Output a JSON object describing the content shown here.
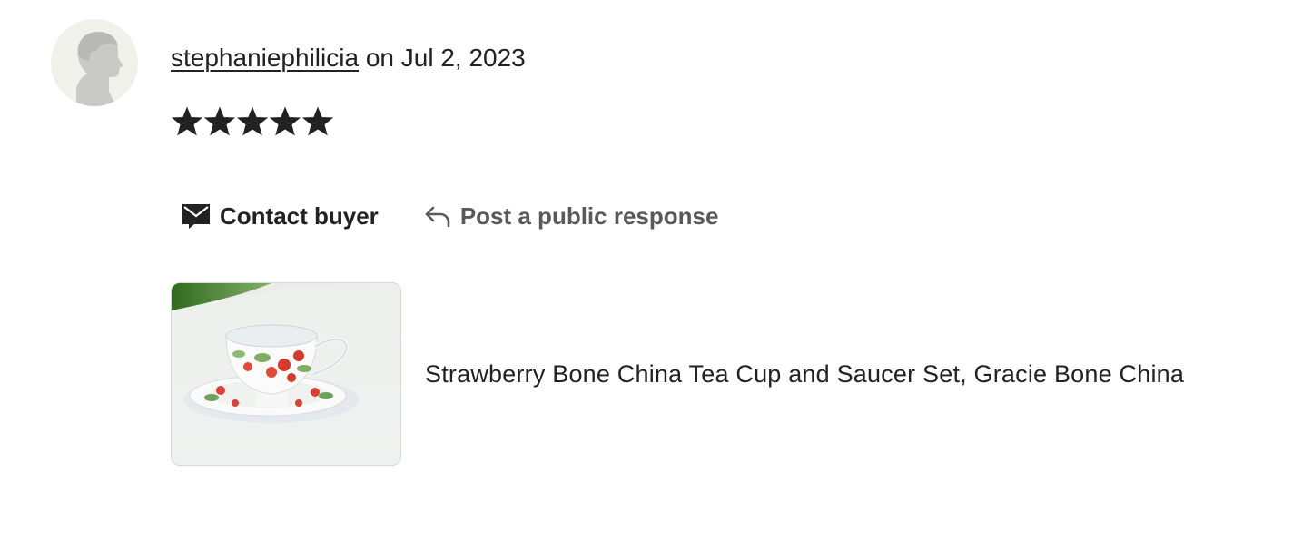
{
  "review": {
    "username": "stephaniephilicia",
    "date_text": "on Jul 2, 2023",
    "rating": 5,
    "rating_max": 5
  },
  "actions": {
    "contact_label": "Contact buyer",
    "respond_label": "Post a public response"
  },
  "listing": {
    "title": "Strawberry Bone China Tea Cup and Saucer Set, Gracie Bone China"
  },
  "icons": {
    "avatar": "default-avatar-icon",
    "star": "star-icon",
    "contact": "envelope-icon",
    "respond": "reply-arrow-icon"
  },
  "colors": {
    "text": "#222222",
    "secondary_text": "#595959",
    "avatar_bg": "#f1f1ec",
    "star": "#222222"
  }
}
